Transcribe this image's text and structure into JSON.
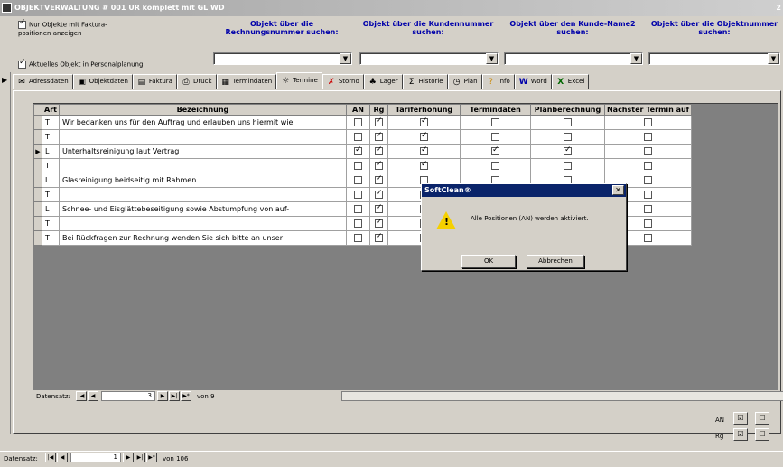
{
  "window": {
    "title": "OBJEKTVERWALTUNG   #  001  UR komplett mit GL WD",
    "right_text": "2"
  },
  "header": {
    "options": [
      {
        "label": "Nur Objekte mit Faktura-positionen anzeigen",
        "checked": true
      },
      {
        "label": "Aktuelles Objekt in Personalplanung",
        "checked": true
      }
    ],
    "searches": [
      {
        "label": "Objekt über die Rechnungsnummer suchen:",
        "value": ""
      },
      {
        "label": "Objekt über die Kundennummer suchen:",
        "value": ""
      },
      {
        "label": "Objekt über den Kunde-Name2 suchen:",
        "value": ""
      },
      {
        "label": "Objekt über die Objektnummer suchen:",
        "value": ""
      }
    ]
  },
  "tabs": [
    {
      "label": "Adressdaten",
      "icon": "address-icon"
    },
    {
      "label": "Objektdaten",
      "icon": "object-icon"
    },
    {
      "label": "Faktura",
      "icon": "invoice-icon"
    },
    {
      "label": "Druck",
      "icon": "printer-icon"
    },
    {
      "label": "Termindaten",
      "icon": "calendar-icon"
    },
    {
      "label": "Termine",
      "icon": "sun-icon",
      "active": true
    },
    {
      "label": "Storno",
      "icon": "cancel-x-icon"
    },
    {
      "label": "Lager",
      "icon": "warehouse-icon"
    },
    {
      "label": "Historie",
      "icon": "sigma-icon"
    },
    {
      "label": "Plan",
      "icon": "clock-icon"
    },
    {
      "label": "Info",
      "icon": "question-icon"
    },
    {
      "label": "Word",
      "icon": "word-icon"
    },
    {
      "label": "Excel",
      "icon": "excel-icon"
    }
  ],
  "grid": {
    "columns": [
      "Art",
      "Bezeichnung",
      "AN",
      "Rg",
      "Tariferhöhung",
      "Termindaten",
      "Planberechnung",
      "Nächster Termin auf"
    ],
    "rows": [
      {
        "art": "T",
        "text": "Wir bedanken uns für den Auftrag und erlauben uns hiermit wie",
        "an": false,
        "rg": true,
        "tarif": true,
        "termin": false,
        "plan": false,
        "next": false
      },
      {
        "art": "T",
        "text": "",
        "an": false,
        "rg": true,
        "tarif": true,
        "termin": false,
        "plan": false,
        "next": false
      },
      {
        "art": "L",
        "text": "Unterhaltsreinigung laut Vertrag",
        "an": true,
        "rg": true,
        "tarif": true,
        "termin": true,
        "plan": true,
        "next": false,
        "current": true
      },
      {
        "art": "T",
        "text": "",
        "an": false,
        "rg": true,
        "tarif": true,
        "termin": false,
        "plan": false,
        "next": false
      },
      {
        "art": "L",
        "text": "Glasreinigung beidseitig mit Rahmen",
        "an": false,
        "rg": true,
        "tarif": false,
        "termin": false,
        "plan": false,
        "next": false
      },
      {
        "art": "T",
        "text": "",
        "an": false,
        "rg": true,
        "tarif": false,
        "termin": false,
        "plan": false,
        "next": false
      },
      {
        "art": "L",
        "text": "Schnee- und Eisglättebeseitigung sowie Abstumpfung von auf-",
        "an": false,
        "rg": true,
        "tarif": false,
        "termin": false,
        "plan": false,
        "next": false
      },
      {
        "art": "T",
        "text": "",
        "an": false,
        "rg": true,
        "tarif": false,
        "termin": false,
        "plan": false,
        "next": false
      },
      {
        "art": "T",
        "text": "Bei Rückfragen zur Rechnung  wenden Sie sich bitte an unser",
        "an": false,
        "rg": true,
        "tarif": false,
        "termin": false,
        "plan": false,
        "next": false
      }
    ]
  },
  "subnav": {
    "label": "Datensatz:",
    "current": "3",
    "of": "von 9"
  },
  "toggles": {
    "an_label": "AN",
    "rg_label": "Rg"
  },
  "mainnav": {
    "label": "Datensatz:",
    "current": "1",
    "of": "von 106"
  },
  "dialog": {
    "title": "SoftClean®",
    "message": "Alle Positionen (AN) werden aktiviert.",
    "ok": "OK",
    "cancel": "Abbrechen"
  }
}
